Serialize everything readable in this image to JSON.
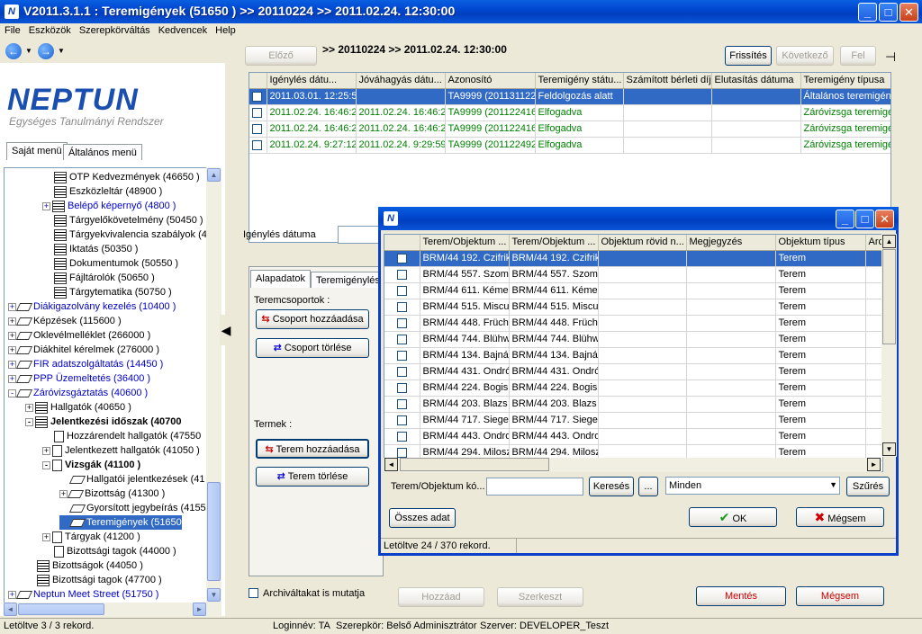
{
  "window": {
    "title": "V2011.3.1.1 : Teremigények (51650  )  >> 20110224 >> 2011.02.24. 12:30:00",
    "app_icon": "N"
  },
  "menu": [
    "File",
    "Eszközök",
    "Szerepkörváltás",
    "Kedvencek",
    "Help"
  ],
  "logo": {
    "name": "NEPTUN",
    "subtitle": "Egységes Tanulmányi Rendszer"
  },
  "left_tabs": [
    "Saját menü",
    "Általános menü"
  ],
  "tree": [
    {
      "label": "OTP Kedvezmények (46650  )",
      "indent": 2,
      "icon": "docs",
      "style": "",
      "exp": ""
    },
    {
      "label": "Eszközleltár (48900  )",
      "indent": 2,
      "icon": "docs",
      "style": "",
      "exp": ""
    },
    {
      "label": "Belépő képernyő (4800  )",
      "indent": 2,
      "icon": "docs",
      "style": "blue",
      "exp": "+"
    },
    {
      "label": "Tárgyelőkövetelmény (50450  )",
      "indent": 2,
      "icon": "docs",
      "style": "",
      "exp": ""
    },
    {
      "label": "Tárgyekvivalencia szabályok (49950",
      "indent": 2,
      "icon": "docs",
      "style": "",
      "exp": ""
    },
    {
      "label": "Iktatás (50350  )",
      "indent": 2,
      "icon": "docs",
      "style": "",
      "exp": ""
    },
    {
      "label": "Dokumentumok (50550  )",
      "indent": 2,
      "icon": "docs",
      "style": "",
      "exp": ""
    },
    {
      "label": "Fájltárolók (50650  )",
      "indent": 2,
      "icon": "docs",
      "style": "",
      "exp": ""
    },
    {
      "label": "Tárgytematika (50750  )",
      "indent": 2,
      "icon": "docs",
      "style": "",
      "exp": ""
    },
    {
      "label": "Diákigazolvány kezelés (10400  )",
      "indent": 0,
      "icon": "diamond",
      "style": "blue",
      "exp": "+"
    },
    {
      "label": "Képzések (115600  )",
      "indent": 0,
      "icon": "diamond",
      "style": "",
      "exp": "+"
    },
    {
      "label": "Oklevélmelléklet (266000  )",
      "indent": 0,
      "icon": "diamond",
      "style": "",
      "exp": "+"
    },
    {
      "label": "Diákhitel kérelmek (276000  )",
      "indent": 0,
      "icon": "diamond",
      "style": "",
      "exp": "+"
    },
    {
      "label": "FIR adatszolgáltatás (14450  )",
      "indent": 0,
      "icon": "diamond",
      "style": "blue",
      "exp": "+"
    },
    {
      "label": "PPP Üzemeltetés (36400  )",
      "indent": 0,
      "icon": "diamond",
      "style": "blue",
      "exp": "+"
    },
    {
      "label": "Záróvizsgáztatás (40600  )",
      "indent": 0,
      "icon": "diamond",
      "style": "blue",
      "exp": "-"
    },
    {
      "label": "Hallgatók (40650  )",
      "indent": 1,
      "icon": "docs",
      "style": "",
      "exp": "+"
    },
    {
      "label": "Jelentkezési időszak (40700",
      "indent": 1,
      "icon": "docs",
      "style": "bold",
      "exp": "-"
    },
    {
      "label": "Hozzárendelt hallgatók (47550",
      "indent": 2,
      "icon": "doc",
      "style": "",
      "exp": ""
    },
    {
      "label": "Jelentkezett hallgatók (41050  )",
      "indent": 2,
      "icon": "doc",
      "style": "",
      "exp": "+"
    },
    {
      "label": "Vizsgák (41100  )",
      "indent": 2,
      "icon": "doc",
      "style": "bold",
      "exp": "-"
    },
    {
      "label": "Hallgatói jelentkezések (41",
      "indent": 3,
      "icon": "diamond",
      "style": "",
      "exp": ""
    },
    {
      "label": "Bizottság (41300  )",
      "indent": 3,
      "icon": "diamond",
      "style": "",
      "exp": "+"
    },
    {
      "label": "Gyorsított jegybeírás (41550",
      "indent": 3,
      "icon": "diamond",
      "style": "",
      "exp": ""
    },
    {
      "label": "Teremigények (51650",
      "indent": 3,
      "icon": "diamond",
      "style": "sel",
      "exp": ""
    },
    {
      "label": "Tárgyak (41200  )",
      "indent": 2,
      "icon": "doc",
      "style": "",
      "exp": "+"
    },
    {
      "label": "Bizottsági tagok (44000  )",
      "indent": 2,
      "icon": "doc",
      "style": "",
      "exp": ""
    },
    {
      "label": "Bizottságok (44050  )",
      "indent": 1,
      "icon": "docs",
      "style": "",
      "exp": ""
    },
    {
      "label": "Bizottsági tagok (47700  )",
      "indent": 1,
      "icon": "docs",
      "style": "",
      "exp": ""
    },
    {
      "label": "Neptun Meet Street (51750  )",
      "indent": 0,
      "icon": "diamond",
      "style": "blue",
      "exp": "+"
    }
  ],
  "status": {
    "records": "Letöltve 3 / 3 rekord.",
    "login": "Loginnév: TA",
    "role": "Szerepkör: Belső Adminisztrátor",
    "server": "Szerver: DEVELOPER_Teszt"
  },
  "main": {
    "prev_label": "Előző",
    "breadcrumb": ">> 20110224 >> 2011.02.24. 12:30:00",
    "refresh_label": "Frissítés",
    "next_label": "Következő",
    "up_label": "Fel",
    "columns": [
      "Igénylés dátu...",
      "Jóváhagyás dátu...",
      "Azonosító",
      "Teremigény státu...",
      "Számított bérleti díj",
      "Elutasítás dátuma",
      "Teremigény típusa"
    ],
    "rows": [
      {
        "cells": [
          "2011.03.01. 12:25:5",
          "",
          "TA9999 (201131122",
          "Feldolgozás alatt",
          "",
          "",
          "Általános teremigény"
        ],
        "style": "hsel"
      },
      {
        "cells": [
          "2011.02.24. 16:46:2",
          "2011.02.24. 16:46:2",
          "TA9999 (201122416",
          "Elfogadva",
          "",
          "",
          "Záróvizsga teremigé"
        ],
        "style": "green"
      },
      {
        "cells": [
          "2011.02.24. 16:46:2",
          "2011.02.24. 16:46:2",
          "TA9999 (201122416",
          "Elfogadva",
          "",
          "",
          "Záróvizsga teremigé"
        ],
        "style": "green"
      },
      {
        "cells": [
          "2011.02.24. 9:27:12",
          "2011.02.24. 9:29:59",
          "TA9999 (201122492",
          "Elfogadva",
          "",
          "",
          "Záróvizsga teremigé"
        ],
        "style": "green"
      }
    ],
    "filter_label": "Igénylés dátuma",
    "detail_tabs": [
      "Alapadatok",
      "Teremigénylési"
    ],
    "groups_label": "Teremcsoportok :",
    "add_group": "Csoport hozzáadása",
    "del_group": "Csoport törlése",
    "rooms_label": "Termek :",
    "add_room": "Terem hozzáadása",
    "del_room": "Terem törlése",
    "archived_label": "Archiváltakat is mutatja",
    "add_label": "Hozzáad",
    "edit_label": "Szerkeszt",
    "save_label": "Mentés",
    "cancel_label": "Mégsem"
  },
  "dialog": {
    "columns": [
      "Terem/Objektum ...",
      "Terem/Objektum ...",
      "Objektum rövid n...",
      "Megjegyzés",
      "Objektum típus",
      "Arc"
    ],
    "rows": [
      [
        "BRM/44 192. Czifrik",
        "BRM/44 192. Czifrik",
        "",
        "",
        "Terem"
      ],
      [
        "BRM/44 557. Szomb",
        "BRM/44 557. Szomb",
        "",
        "",
        "Terem"
      ],
      [
        "BRM/44 611. Kémei",
        "BRM/44 611. Kémei",
        "",
        "",
        "Terem"
      ],
      [
        "BRM/44 515. Miscu",
        "BRM/44 515. Miscu",
        "",
        "",
        "Terem"
      ],
      [
        "BRM/44 448. Früch",
        "BRM/44 448. Früch",
        "",
        "",
        "Terem"
      ],
      [
        "BRM/44 744. Blühw",
        "BRM/44 744. Blühw",
        "",
        "",
        "Terem"
      ],
      [
        "BRM/44 134. Bajná",
        "BRM/44 134. Bajná",
        "",
        "",
        "Terem"
      ],
      [
        "BRM/44 431. Ondró",
        "BRM/44 431. Ondró",
        "",
        "",
        "Terem"
      ],
      [
        "BRM/44 224. Bogisi",
        "BRM/44 224. Bogisi",
        "",
        "",
        "Terem"
      ],
      [
        "BRM/44 203. Blazs",
        "BRM/44 203. Blazs",
        "",
        "",
        "Terem"
      ],
      [
        "BRM/44 717. Siegel",
        "BRM/44 717. Siegel",
        "",
        "",
        "Terem"
      ],
      [
        "BRM/44 443. Ondro",
        "BRM/44 443. Ondro",
        "",
        "",
        "Terem"
      ],
      [
        "BRM/44 294. Milosz",
        "BRM/44 294. Milosz",
        "",
        "",
        "Terem"
      ]
    ],
    "search_label": "Terem/Objektum kó...",
    "search_button": "Keresés",
    "ellipsis_button": "...",
    "filter_value": "Minden",
    "filter_button": "Szűrés",
    "all_button": "Összes adat",
    "ok_button": "OK",
    "cancel_button": "Mégsem",
    "status": "Letöltve 24 / 370 rekord."
  }
}
